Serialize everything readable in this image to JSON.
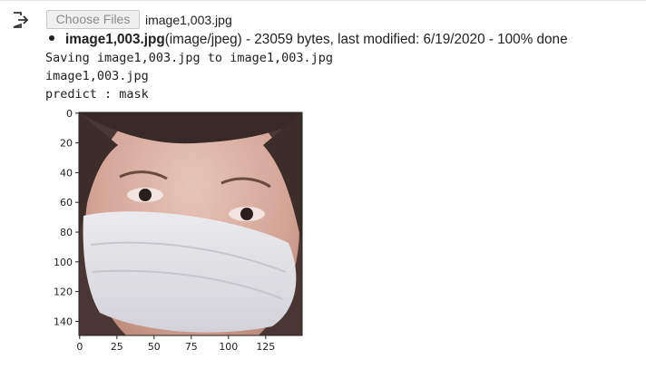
{
  "upload": {
    "button_label": "Choose Files",
    "selected_file": "image1,003.jpg"
  },
  "file_info": {
    "name": "image1,003.jpg",
    "details": "(image/jpeg) - 23059 bytes, last modified: 6/19/2020 - 100% done"
  },
  "stdout": {
    "line1": "Saving image1,003.jpg to image1,003.jpg",
    "line2": "image1,003.jpg",
    "line3": "predict : mask"
  },
  "plot": {
    "type": "image",
    "description_free": true,
    "y_ticks": [
      "0",
      "20",
      "40",
      "60",
      "80",
      "100",
      "120",
      "140"
    ],
    "x_ticks": [
      "0",
      "25",
      "50",
      "75",
      "100",
      "125"
    ],
    "xlim": [
      -0.5,
      149.5
    ],
    "ylim": [
      149.5,
      -0.5
    ]
  },
  "icons": {
    "output": "output-arrow-icon"
  }
}
